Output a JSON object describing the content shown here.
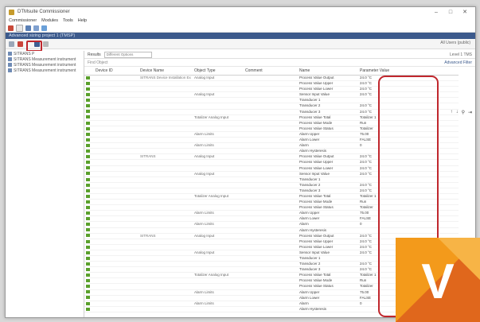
{
  "window": {
    "title": "DTMsuite Commissioner",
    "controls": [
      "–",
      "□",
      "✕"
    ]
  },
  "menu": [
    "Commissioner",
    "Modules",
    "Tools",
    "Help"
  ],
  "docbar": {
    "label": "Advanced sizing project 1 (TMSP)"
  },
  "toolbar2": {
    "right_text": "All Users (public)"
  },
  "tree": [
    "SITRANS P",
    "SITRANS Measurement instrument",
    "SITRANS Measurement instrument",
    "SITRANS Measurement instrument"
  ],
  "right_top": {
    "label": "Results",
    "field": "Different Options",
    "right": "Level 1 TMS"
  },
  "filter": {
    "placeholder": "Find Object",
    "right": "Advanced Filter"
  },
  "table": {
    "headers": [
      "Device ID",
      "Device Name",
      "Object Type",
      "Comment",
      "Name",
      "Parameter Value"
    ],
    "rows": [
      {
        "id": "",
        "name": "SITRANS Device Installation Example",
        "type": "Analog Input",
        "comment": "",
        "param": "Process Value Output",
        "value": "24.0 °C"
      },
      {
        "id": "",
        "name": "",
        "type": "",
        "comment": "",
        "param": "Process Value Upper",
        "value": "24.0 °C"
      },
      {
        "id": "",
        "name": "",
        "type": "",
        "comment": "",
        "param": "Process Value Lower",
        "value": "24.0 °C"
      },
      {
        "id": "",
        "name": "",
        "type": "Analog Input",
        "comment": "",
        "param": "Sensor Input Value",
        "value": "24.0 °C"
      },
      {
        "id": "",
        "name": "",
        "type": "",
        "comment": "",
        "param": "Transducer 1",
        "value": ""
      },
      {
        "id": "",
        "name": "",
        "type": "",
        "comment": "",
        "param": "Transducer 2",
        "value": "24.0 °C"
      },
      {
        "id": "",
        "name": "",
        "type": "",
        "comment": "",
        "param": "Transducer 3",
        "value": "24.0 °C"
      },
      {
        "id": "",
        "name": "",
        "type": "Totalizer Analog Input",
        "comment": "",
        "param": "Process Value Total",
        "value": "Totalizer 1"
      },
      {
        "id": "",
        "name": "",
        "type": "",
        "comment": "",
        "param": "Process Value Mode",
        "value": "Run"
      },
      {
        "id": "",
        "name": "",
        "type": "",
        "comment": "",
        "param": "Process Value Status",
        "value": "Totalizer"
      },
      {
        "id": "",
        "name": "",
        "type": "Alarm Limits",
        "comment": "",
        "param": "Alarm Upper",
        "value": "75.00"
      },
      {
        "id": "",
        "name": "",
        "type": "",
        "comment": "",
        "param": "Alarm Lower",
        "value": "FALSE"
      },
      {
        "id": "",
        "name": "",
        "type": "Alarm Limits",
        "comment": "",
        "param": "Alarm",
        "value": "0"
      },
      {
        "id": "",
        "name": "",
        "type": "",
        "comment": "",
        "param": "Alarm Hysteresis",
        "value": ""
      },
      {
        "id": "",
        "name": "SITRANS",
        "type": "Analog Input",
        "comment": "",
        "param": "Process Value Output",
        "value": "24.0 °C"
      },
      {
        "id": "",
        "name": "",
        "type": "",
        "comment": "",
        "param": "Process Value Upper",
        "value": "24.0 °C"
      },
      {
        "id": "",
        "name": "",
        "type": "",
        "comment": "",
        "param": "Process Value Lower",
        "value": "24.0 °C"
      },
      {
        "id": "",
        "name": "",
        "type": "Analog Input",
        "comment": "",
        "param": "Sensor Input Value",
        "value": "24.0 °C"
      },
      {
        "id": "",
        "name": "",
        "type": "",
        "comment": "",
        "param": "Transducer 1",
        "value": ""
      },
      {
        "id": "",
        "name": "",
        "type": "",
        "comment": "",
        "param": "Transducer 2",
        "value": "24.0 °C"
      },
      {
        "id": "",
        "name": "",
        "type": "",
        "comment": "",
        "param": "Transducer 3",
        "value": "24.0 °C"
      },
      {
        "id": "",
        "name": "",
        "type": "Totalizer Analog Input",
        "comment": "",
        "param": "Process Value Total",
        "value": "Totalizer 1"
      },
      {
        "id": "",
        "name": "",
        "type": "",
        "comment": "",
        "param": "Process Value Mode",
        "value": "Run"
      },
      {
        "id": "",
        "name": "",
        "type": "",
        "comment": "",
        "param": "Process Value Status",
        "value": "Totalizer"
      },
      {
        "id": "",
        "name": "",
        "type": "Alarm Limits",
        "comment": "",
        "param": "Alarm Upper",
        "value": "75.00"
      },
      {
        "id": "",
        "name": "",
        "type": "",
        "comment": "",
        "param": "Alarm Lower",
        "value": "FALSE"
      },
      {
        "id": "",
        "name": "",
        "type": "Alarm Limits",
        "comment": "",
        "param": "Alarm",
        "value": "0"
      },
      {
        "id": "",
        "name": "",
        "type": "",
        "comment": "",
        "param": "Alarm Hysteresis",
        "value": ""
      },
      {
        "id": "",
        "name": "SITRANS",
        "type": "Analog Input",
        "comment": "",
        "param": "Process Value Output",
        "value": "24.0 °C"
      },
      {
        "id": "",
        "name": "",
        "type": "",
        "comment": "",
        "param": "Process Value Upper",
        "value": "24.0 °C"
      },
      {
        "id": "",
        "name": "",
        "type": "",
        "comment": "",
        "param": "Process Value Lower",
        "value": "24.0 °C"
      },
      {
        "id": "",
        "name": "",
        "type": "Analog Input",
        "comment": "",
        "param": "Sensor Input Value",
        "value": "24.0 °C"
      },
      {
        "id": "",
        "name": "",
        "type": "",
        "comment": "",
        "param": "Transducer 1",
        "value": ""
      },
      {
        "id": "",
        "name": "",
        "type": "",
        "comment": "",
        "param": "Transducer 2",
        "value": "24.0 °C"
      },
      {
        "id": "",
        "name": "",
        "type": "",
        "comment": "",
        "param": "Transducer 3",
        "value": "24.0 °C"
      },
      {
        "id": "",
        "name": "",
        "type": "Totalizer Analog Input",
        "comment": "",
        "param": "Process Value Total",
        "value": "Totalizer 1"
      },
      {
        "id": "",
        "name": "",
        "type": "",
        "comment": "",
        "param": "Process Value Mode",
        "value": "Run"
      },
      {
        "id": "",
        "name": "",
        "type": "",
        "comment": "",
        "param": "Process Value Status",
        "value": "Totalizer"
      },
      {
        "id": "",
        "name": "",
        "type": "Alarm Limits",
        "comment": "",
        "param": "Alarm Upper",
        "value": "75.00"
      },
      {
        "id": "",
        "name": "",
        "type": "",
        "comment": "",
        "param": "Alarm Lower",
        "value": "FALSE"
      },
      {
        "id": "",
        "name": "",
        "type": "Alarm Limits",
        "comment": "",
        "param": "Alarm",
        "value": "0"
      },
      {
        "id": "",
        "name": "",
        "type": "",
        "comment": "",
        "param": "Alarm Hysteresis",
        "value": ""
      }
    ]
  },
  "colors": {
    "highlight": "#c0272d",
    "logo_orange": "#f39a1b",
    "logo_dark": "#e0671c"
  },
  "logo": {
    "letter": "V"
  }
}
